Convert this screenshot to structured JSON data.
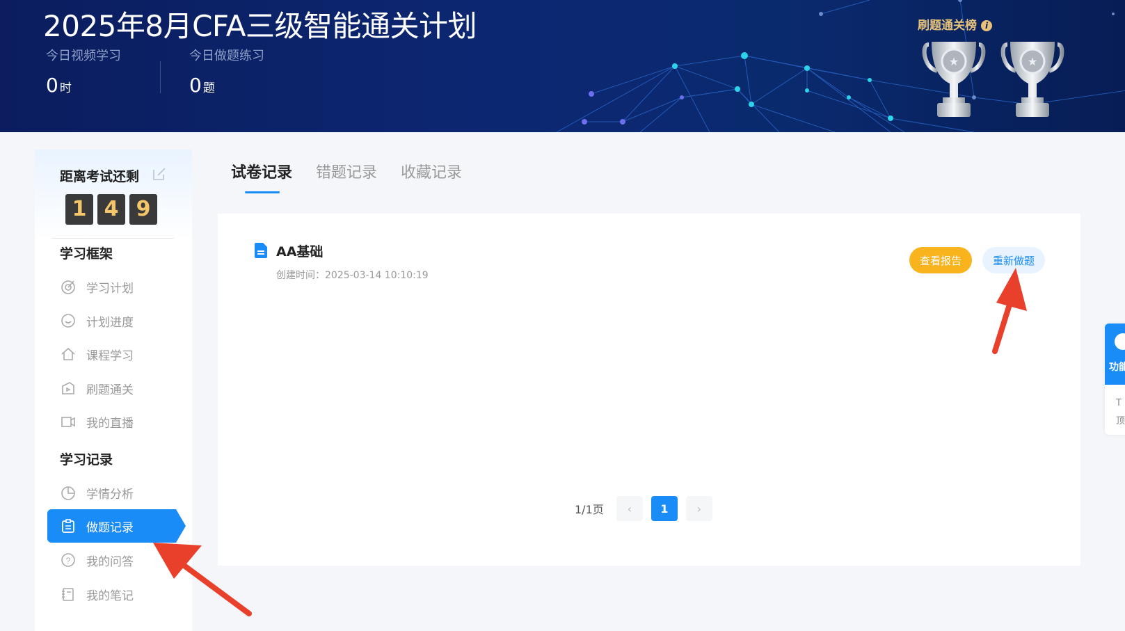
{
  "header": {
    "title": "2025年8月CFA三级智能通关计划",
    "stats": [
      {
        "label": "今日视频学习",
        "value": "0",
        "unit": "时"
      },
      {
        "label": "今日做题练习",
        "value": "0",
        "unit": "题"
      }
    ],
    "ranking_label": "刷题通关榜",
    "ranking_info_icon": "i"
  },
  "sidebar": {
    "countdown_title": "距离考试还剩",
    "countdown_digits": [
      "1",
      "4",
      "9"
    ],
    "section1_title": "学习框架",
    "section1_items": [
      {
        "label": "学习计划",
        "icon": "target-icon"
      },
      {
        "label": "计划进度",
        "icon": "progress-icon"
      },
      {
        "label": "课程学习",
        "icon": "home-icon"
      },
      {
        "label": "刷题通关",
        "icon": "practice-icon"
      },
      {
        "label": "我的直播",
        "icon": "video-icon"
      }
    ],
    "section2_title": "学习记录",
    "section2_items": [
      {
        "label": "学情分析",
        "icon": "pie-chart-icon"
      },
      {
        "label": "做题记录",
        "icon": "clipboard-icon",
        "active": true
      },
      {
        "label": "我的问答",
        "icon": "question-icon"
      },
      {
        "label": "我的笔记",
        "icon": "notebook-icon"
      }
    ]
  },
  "tabs": [
    {
      "label": "试卷记录",
      "active": true
    },
    {
      "label": "错题记录",
      "active": false
    },
    {
      "label": "收藏记录",
      "active": false
    }
  ],
  "records": [
    {
      "title": "AA基础",
      "created": "创建时间：2025-03-14 10:10:19",
      "report_button": "查看报告",
      "redo_button": "重新做题"
    }
  ],
  "pagination": {
    "info": "1/1页",
    "prev": "‹",
    "current": "1",
    "next": "›"
  },
  "float_widget": {
    "label": "功能",
    "bottom_text_1": "T",
    "bottom_text_2": "顶"
  },
  "colors": {
    "accent": "#1a8cf8",
    "report_button": "#f9b31c",
    "banner": "#0b1d5e",
    "arrow": "#e8402a",
    "digit_bg": "#3a3a3a",
    "digit_text": "#f3c66a"
  }
}
